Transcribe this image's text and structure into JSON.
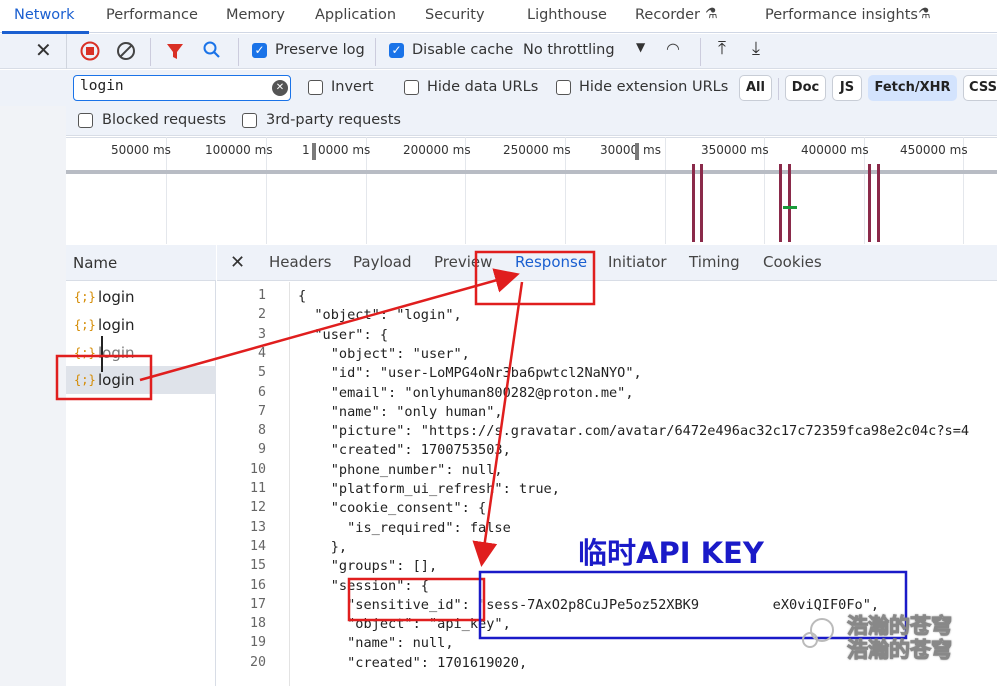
{
  "tabs": [
    {
      "label": "Network",
      "active": true
    },
    {
      "label": "Performance"
    },
    {
      "label": "Memory"
    },
    {
      "label": "Application"
    },
    {
      "label": "Security"
    },
    {
      "label": "Lighthouse"
    },
    {
      "label": "Recorder"
    },
    {
      "label": "Performance insights"
    }
  ],
  "toolbar": {
    "preserve_log": "Preserve log",
    "disable_cache": "Disable cache",
    "throttling": "No throttling"
  },
  "filter": {
    "value": "login",
    "invert": "Invert",
    "hide_data_urls": "Hide data URLs",
    "hide_extension_urls": "Hide extension URLs",
    "chips": [
      "All",
      "Doc",
      "JS",
      "Fetch/XHR",
      "CSS"
    ],
    "blocked": "Blocked requests",
    "third_party": "3rd-party requests"
  },
  "timeline": {
    "ticks": [
      "50000 ms",
      "100000 ms",
      "1",
      "0000 ms",
      "200000 ms",
      "250000 ms",
      "30000",
      "ms",
      "350000 ms",
      "400000 ms",
      "450000 ms"
    ]
  },
  "requests": {
    "header": "Name",
    "items": [
      "login",
      "login",
      "login",
      "login"
    ],
    "icon": "{;}"
  },
  "detail_tabs": [
    "Headers",
    "Payload",
    "Preview",
    "Response",
    "Initiator",
    "Timing",
    "Cookies"
  ],
  "response": {
    "line_numbers": [
      "1",
      "2",
      "3",
      "4",
      "5",
      "6",
      "7",
      "8",
      "9",
      "10",
      "11",
      "12",
      "13",
      "14",
      "15",
      "16",
      "17",
      "18",
      "19",
      "20"
    ],
    "lines": [
      "{",
      "  \"object\": \"login\",",
      "  \"user\": {",
      "    \"object\": \"user\",",
      "    \"id\": \"user-LoMPG4oNr3ba6pwtcl2NaNYO\",",
      "    \"email\": \"onlyhuman800282@proton.me\",",
      "    \"name\": \"only human\",",
      "    \"picture\": \"https://s.gravatar.com/avatar/6472e496ac32c17c72359fca98e2c04c?s=4",
      "    \"created\": 1700753503,",
      "    \"phone_number\": null,",
      "    \"platform_ui_refresh\": true,",
      "    \"cookie_consent\": {",
      "      \"is_required\": false",
      "    },",
      "    \"groups\": [],",
      "    \"session\": {",
      "      \"sensitive_id\": \"sess-7AxO2p8CuJPe5oz52XBK9         eX0viQIF0Fo\",",
      "      \"object\": \"api_key\",",
      "      \"name\": null,",
      "      \"created\": 1701619020,"
    ]
  },
  "annotation": {
    "title": "临时API KEY",
    "color_red": "#e01e1e",
    "color_blue": "#1a1ac8"
  },
  "watermark": "浩瀚的苍穹"
}
